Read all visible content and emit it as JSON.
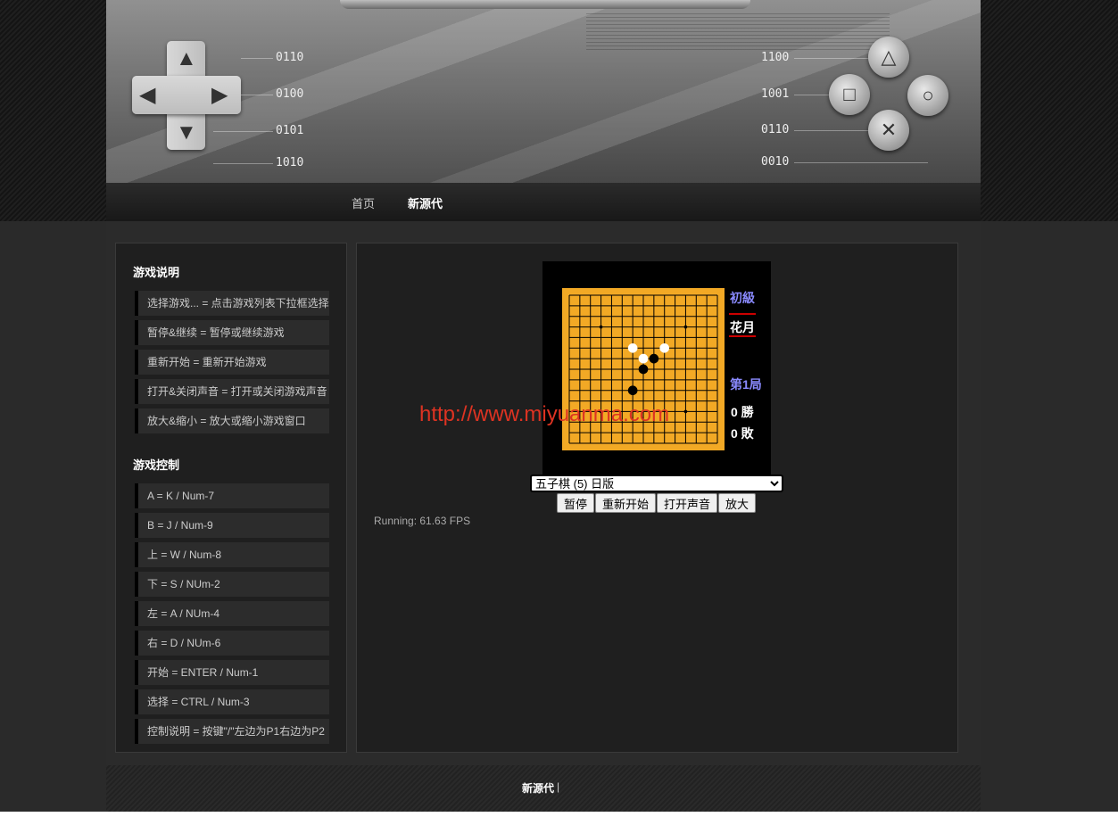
{
  "header": {
    "left_codes": [
      "0110",
      "0100",
      "0101",
      "1010"
    ],
    "right_codes": [
      "1100",
      "1001",
      "0110",
      "0010"
    ]
  },
  "nav": {
    "items": [
      "首页",
      "新源代"
    ]
  },
  "sidebar": {
    "instructions_title": "游戏说明",
    "instructions": [
      "选择游戏... = 点击游戏列表下拉框选择",
      "暂停&继续 = 暂停或继续游戏",
      "重新开始 = 重新开始游戏",
      "打开&关闭声音 = 打开或关闭游戏声音",
      "放大&缩小 = 放大或缩小游戏窗口"
    ],
    "controls_title": "游戏控制",
    "controls": [
      "A = K / Num-7",
      "B = J / Num-9",
      "上 = W / Num-8",
      "下 = S / NUm-2",
      "左 = A / NUm-4",
      "右 = D / NUm-6",
      "开始 = ENTER / Num-1",
      "选择 = CTRL / Num-3",
      "控制说明 = 按键\"/\"左边为P1右边为P2"
    ]
  },
  "game": {
    "level": "初級",
    "player": "花月",
    "round": "第1局",
    "wins": "0 勝",
    "losses": "0 敗",
    "board_size": 15,
    "stones": [
      {
        "col": 6,
        "row": 5,
        "color": "white"
      },
      {
        "col": 9,
        "row": 5,
        "color": "white"
      },
      {
        "col": 7,
        "row": 6,
        "color": "white"
      },
      {
        "col": 8,
        "row": 6,
        "color": "black"
      },
      {
        "col": 7,
        "row": 7,
        "color": "black"
      },
      {
        "col": 6,
        "row": 9,
        "color": "black"
      }
    ],
    "colors": {
      "board": "#f2a925",
      "frame": "#000000",
      "level": "#8a8aff",
      "round": "#8a8aff"
    }
  },
  "watermark": "http://www.miyuanma.com",
  "select": {
    "value": "五子棋 (5) 日版"
  },
  "buttons": {
    "pause": "暂停",
    "restart": "重新开始",
    "sound": "打开声音",
    "zoom": "放大"
  },
  "status": {
    "fps": "Running: 61.63 FPS"
  },
  "footer": {
    "link": "新源代",
    "separator": "|"
  }
}
